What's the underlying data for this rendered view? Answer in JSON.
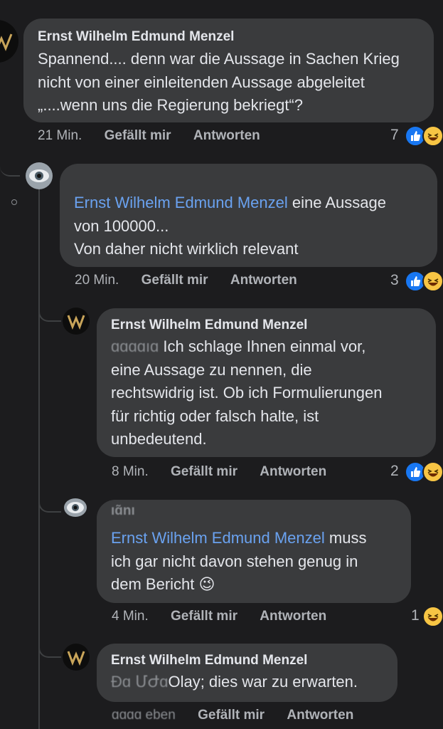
{
  "comments": [
    {
      "author": "Ernst Wilhelm Edmund Menzel",
      "text": "Spannend.... denn war die Aussage in Sachen Krieg nicht von einer einleitenden Aussage abgeleitet „....wenn uns die Regierung bekriegt“?",
      "time": "21 Min.",
      "like_label": "Gefällt mir",
      "reply_label": "Antworten",
      "reaction_count": "7",
      "reactions": [
        "like-icon",
        "haha-icon"
      ]
    },
    {
      "author": "",
      "mention": "Ernst Wilhelm Edmund Menzel",
      "text_line1": " eine Aussage",
      "text_line2": "von 100000...",
      "text_line3": "Von daher nicht wirklich relevant",
      "time": "20 Min.",
      "like_label": "Gefällt mir",
      "reply_label": "Antworten",
      "reaction_count": "3",
      "reactions": [
        "like-icon",
        "haha-icon"
      ]
    },
    {
      "author": "Ernst Wilhelm Edmund Menzel",
      "blur_prefix": "ɑɑɑɑıɑ",
      "text_line1": " Ich schlage Ihnen einmal vor,",
      "text_line2": "eine Aussage zu nennen, die",
      "text_line3": "rechtswidrig ist. Ob ich Formulierungen",
      "text_line4": "für richtig oder falsch halte, ist",
      "text_line5": "unbedeutend.",
      "time": "8 Min.",
      "like_label": "Gefällt mir",
      "reply_label": "Antworten",
      "reaction_count": "2",
      "reactions": [
        "like-icon",
        "haha-icon"
      ]
    },
    {
      "author": "ıɑ̃nı",
      "mention": "Ernst Wilhelm Edmund Menzel",
      "text_line1": " muss",
      "text_line2": "ich gar nicht davon stehen genug in",
      "text_line3": "dem Bericht ",
      "emoji": "😉",
      "time": "4 Min.",
      "like_label": "Gefällt mir",
      "reply_label": "Antworten",
      "reaction_count": "1",
      "reactions": [
        "haha-icon"
      ]
    },
    {
      "author": "Ernst Wilhelm Edmund Menzel",
      "blur_prefix": "Ɖɑ ՄԺɑ",
      "text_line1": "Olay; dies war zu erwarten.",
      "time": "ɑɑɑɑ eben",
      "like_label": "Gefällt mir",
      "reply_label": "Antworten"
    }
  ],
  "colors": {
    "background": "#1c1c1e",
    "bubble": "#3a3b3d",
    "mention": "#6aa2f0",
    "like_blue": "#1877f2",
    "haha_yellow": "#f7c544"
  }
}
